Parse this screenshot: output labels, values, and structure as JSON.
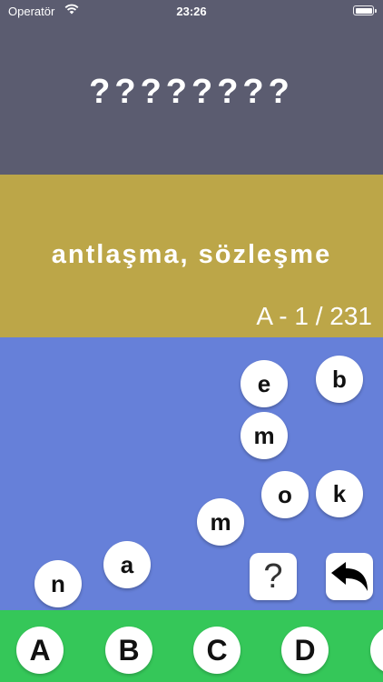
{
  "status_bar": {
    "carrier": "Operatör",
    "time": "23:26"
  },
  "answer": {
    "masked_word": "????????"
  },
  "meaning": {
    "text": "antlaşma, sözleşme",
    "counter": "A - 1 / 231"
  },
  "letter_balls": [
    "e",
    "b",
    "m",
    "o",
    "k",
    "m",
    "a",
    "n"
  ],
  "controls": {
    "hint_label": "?",
    "undo_icon": "undo-arrow-icon"
  },
  "letter_tabs": [
    "A",
    "B",
    "C",
    "D",
    ""
  ],
  "colors": {
    "top": "#5b5c70",
    "meaning": "#bca648",
    "play": "#6680d9",
    "bottom": "#35c759"
  }
}
